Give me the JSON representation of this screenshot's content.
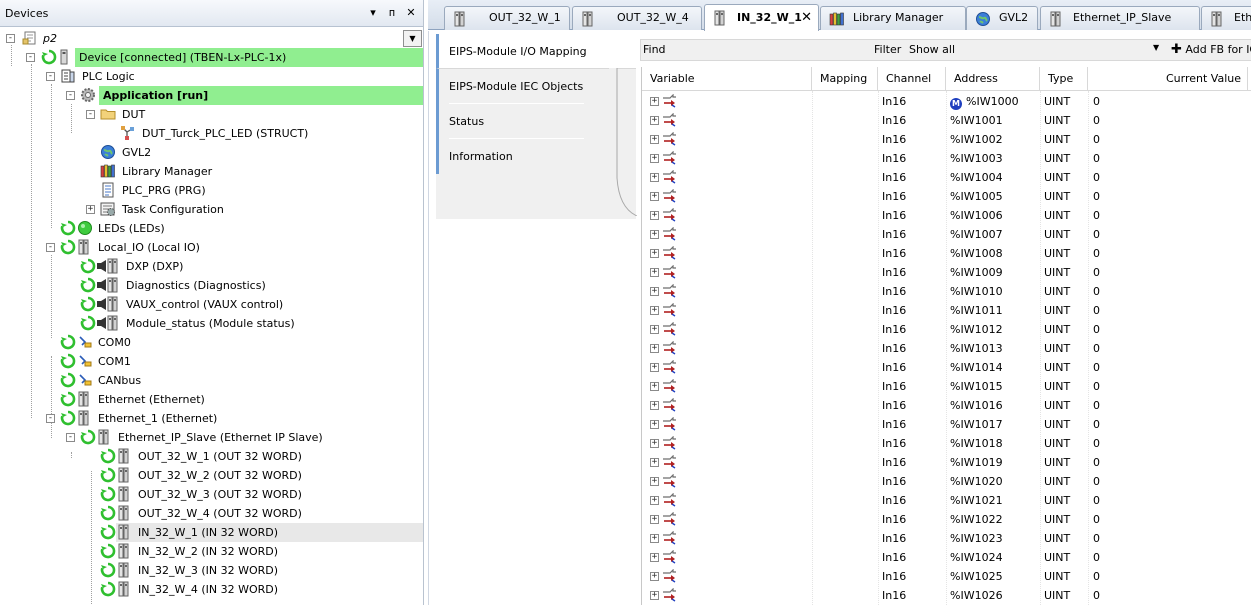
{
  "devices_panel": {
    "title": "Devices",
    "pin_glyph": "▾",
    "float_glyph": "ᴨ",
    "close_glyph": "✕",
    "project_dropdown_glyph": "▼"
  },
  "tree": [
    {
      "label": "p2",
      "italic": true,
      "icon": "project-icon",
      "expander": "-"
    },
    {
      "label": "Device [connected] (TBEN-Lx-PLC-1x)",
      "icon": "device-icon",
      "expander": "-",
      "connected": true
    },
    {
      "label": "PLC Logic",
      "icon": "plc-logic-icon",
      "expander": "-"
    },
    {
      "label": "Application [run]",
      "icon": "application-gear-icon",
      "expander": "-",
      "bold": true,
      "connected": true
    },
    {
      "label": "DUT",
      "icon": "folder-icon",
      "expander": "-"
    },
    {
      "label": "DUT_Turck_PLC_LED (STRUCT)",
      "icon": "struct-icon"
    },
    {
      "label": "GVL2",
      "icon": "gvl-globe-icon"
    },
    {
      "label": "Library Manager",
      "icon": "library-books-icon"
    },
    {
      "label": "PLC_PRG (PRG)",
      "icon": "program-icon"
    },
    {
      "label": "Task Configuration",
      "icon": "task-config-icon",
      "expander": "+"
    },
    {
      "label": "LEDs (LEDs)",
      "icon": "led-icon"
    },
    {
      "label": "Local_IO (Local IO)",
      "icon": "io-module-icon",
      "expander": "-"
    },
    {
      "label": "DXP (DXP)",
      "icon": "io-module-icon"
    },
    {
      "label": "Diagnostics (Diagnostics)",
      "icon": "io-module-icon"
    },
    {
      "label": "VAUX_control (VAUX control)",
      "icon": "io-module-icon"
    },
    {
      "label": "Module_status (Module status)",
      "icon": "io-module-icon"
    },
    {
      "label": "COM0",
      "icon": "serial-port-icon"
    },
    {
      "label": "COM1",
      "icon": "serial-port-icon"
    },
    {
      "label": "CANbus",
      "icon": "serial-port-icon"
    },
    {
      "label": "Ethernet (Ethernet)",
      "icon": "io-module-icon"
    },
    {
      "label": "Ethernet_1 (Ethernet)",
      "icon": "io-module-icon",
      "expander": "-"
    },
    {
      "label": "Ethernet_IP_Slave (Ethernet IP Slave)",
      "icon": "io-module-icon",
      "expander": "-"
    },
    {
      "label": "OUT_32_W_1 (OUT 32 WORD)",
      "icon": "io-module-icon"
    },
    {
      "label": "OUT_32_W_2 (OUT 32 WORD)",
      "icon": "io-module-icon"
    },
    {
      "label": "OUT_32_W_3 (OUT 32 WORD)",
      "icon": "io-module-icon"
    },
    {
      "label": "OUT_32_W_4 (OUT 32 WORD)",
      "icon": "io-module-icon"
    },
    {
      "label": "IN_32_W_1 (IN 32 WORD)",
      "icon": "io-module-icon",
      "selected": true
    },
    {
      "label": "IN_32_W_2 (IN 32 WORD)",
      "icon": "io-module-icon"
    },
    {
      "label": "IN_32_W_3 (IN 32 WORD)",
      "icon": "io-module-icon"
    },
    {
      "label": "IN_32_W_4 (IN 32 WORD)",
      "icon": "io-module-icon"
    }
  ],
  "tabs": [
    {
      "label": "OUT_32_W_1",
      "icon": "io-module-icon"
    },
    {
      "label": "OUT_32_W_4",
      "icon": "io-module-icon"
    },
    {
      "label": "IN_32_W_1",
      "icon": "io-module-icon",
      "active": true,
      "close": "✕"
    },
    {
      "label": "Library Manager",
      "icon": "library-books-icon"
    },
    {
      "label": "GVL2",
      "icon": "gvl-globe-icon"
    },
    {
      "label": "Ethernet_IP_Slave",
      "icon": "io-module-icon"
    },
    {
      "label": "Ethe",
      "icon": "io-module-icon"
    }
  ],
  "side_tabs": [
    {
      "label": "EIPS-Module I/O Mapping",
      "active": true
    },
    {
      "label": "EIPS-Module IEC Objects"
    },
    {
      "label": "Status"
    },
    {
      "label": "Information"
    }
  ],
  "findbar": {
    "find_label": "Find",
    "filter_label": "Filter",
    "filter_value": "Show all",
    "dropdown_glyph": "▼",
    "add_fb_label": "Add FB for IO"
  },
  "table": {
    "columns": [
      "Variable",
      "Mapping",
      "Channel",
      "Address",
      "Type",
      "Current Value"
    ],
    "mapping_badge": "M",
    "rows": [
      {
        "channel": "In16",
        "address": "%IW1000",
        "type": "UINT",
        "value": "0",
        "mapped": true
      },
      {
        "channel": "In16",
        "address": "%IW1001",
        "type": "UINT",
        "value": "0"
      },
      {
        "channel": "In16",
        "address": "%IW1002",
        "type": "UINT",
        "value": "0"
      },
      {
        "channel": "In16",
        "address": "%IW1003",
        "type": "UINT",
        "value": "0"
      },
      {
        "channel": "In16",
        "address": "%IW1004",
        "type": "UINT",
        "value": "0"
      },
      {
        "channel": "In16",
        "address": "%IW1005",
        "type": "UINT",
        "value": "0"
      },
      {
        "channel": "In16",
        "address": "%IW1006",
        "type": "UINT",
        "value": "0"
      },
      {
        "channel": "In16",
        "address": "%IW1007",
        "type": "UINT",
        "value": "0"
      },
      {
        "channel": "In16",
        "address": "%IW1008",
        "type": "UINT",
        "value": "0"
      },
      {
        "channel": "In16",
        "address": "%IW1009",
        "type": "UINT",
        "value": "0"
      },
      {
        "channel": "In16",
        "address": "%IW1010",
        "type": "UINT",
        "value": "0"
      },
      {
        "channel": "In16",
        "address": "%IW1011",
        "type": "UINT",
        "value": "0"
      },
      {
        "channel": "In16",
        "address": "%IW1012",
        "type": "UINT",
        "value": "0"
      },
      {
        "channel": "In16",
        "address": "%IW1013",
        "type": "UINT",
        "value": "0"
      },
      {
        "channel": "In16",
        "address": "%IW1014",
        "type": "UINT",
        "value": "0"
      },
      {
        "channel": "In16",
        "address": "%IW1015",
        "type": "UINT",
        "value": "0"
      },
      {
        "channel": "In16",
        "address": "%IW1016",
        "type": "UINT",
        "value": "0"
      },
      {
        "channel": "In16",
        "address": "%IW1017",
        "type": "UINT",
        "value": "0"
      },
      {
        "channel": "In16",
        "address": "%IW1018",
        "type": "UINT",
        "value": "0"
      },
      {
        "channel": "In16",
        "address": "%IW1019",
        "type": "UINT",
        "value": "0"
      },
      {
        "channel": "In16",
        "address": "%IW1020",
        "type": "UINT",
        "value": "0"
      },
      {
        "channel": "In16",
        "address": "%IW1021",
        "type": "UINT",
        "value": "0"
      },
      {
        "channel": "In16",
        "address": "%IW1022",
        "type": "UINT",
        "value": "0"
      },
      {
        "channel": "In16",
        "address": "%IW1023",
        "type": "UINT",
        "value": "0"
      },
      {
        "channel": "In16",
        "address": "%IW1024",
        "type": "UINT",
        "value": "0"
      },
      {
        "channel": "In16",
        "address": "%IW1025",
        "type": "UINT",
        "value": "0"
      },
      {
        "channel": "In16",
        "address": "%IW1026",
        "type": "UINT",
        "value": "0"
      }
    ]
  }
}
